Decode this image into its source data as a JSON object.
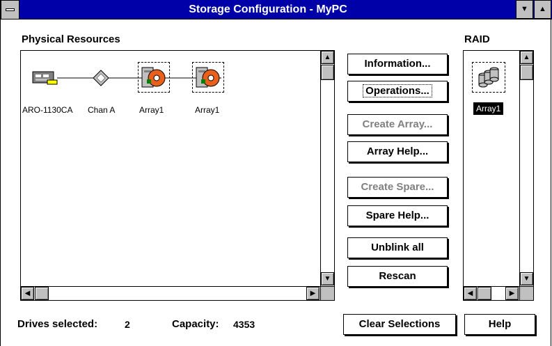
{
  "window": {
    "title": "Storage Configuration - MyPC",
    "min_glyph": "▼",
    "max_glyph": "▲"
  },
  "physical": {
    "label": "Physical Resources",
    "nodes": [
      {
        "label": "ARO-1130CA",
        "icon": "controller-card-icon"
      },
      {
        "label": "Chan A",
        "icon": "channel-diamond-icon"
      },
      {
        "label": "Array1",
        "icon": "disk-drive-icon"
      },
      {
        "label": "Array1",
        "icon": "disk-drive-icon"
      }
    ]
  },
  "buttons": {
    "information": "Information...",
    "operations": "Operations...",
    "create_array": "Create Array...",
    "array_help": "Array Help...",
    "create_spare": "Create Spare...",
    "spare_help": "Spare Help...",
    "unblink_all": "Unblink all",
    "rescan": "Rescan",
    "clear_selections": "Clear Selections",
    "help": "Help"
  },
  "raid": {
    "label": "RAID",
    "items": [
      {
        "label": "Array1",
        "icon": "raid-array-icon"
      }
    ]
  },
  "status": {
    "drives_label": "Drives selected:",
    "drives_value": "2",
    "capacity_label": "Capacity:",
    "capacity_value": "4353"
  },
  "scroll": {
    "up": "▲",
    "down": "▼",
    "left": "◀",
    "right": "▶"
  }
}
